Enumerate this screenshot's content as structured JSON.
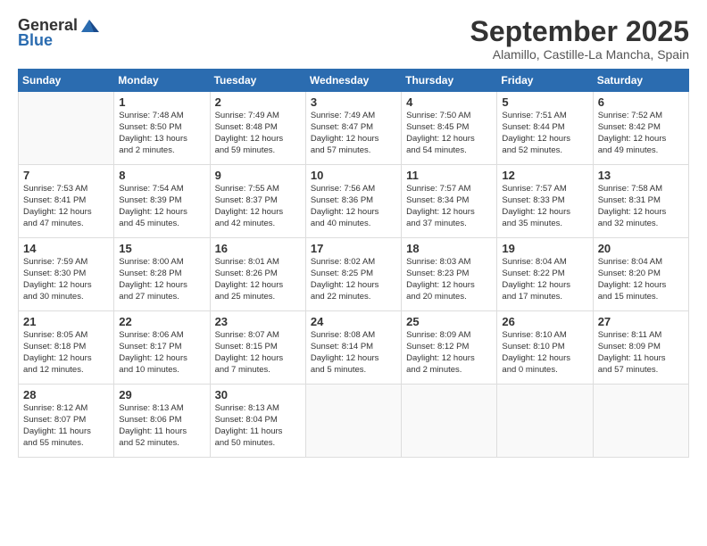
{
  "header": {
    "logo_general": "General",
    "logo_blue": "Blue",
    "month_title": "September 2025",
    "subtitle": "Alamillo, Castille-La Mancha, Spain"
  },
  "days_of_week": [
    "Sunday",
    "Monday",
    "Tuesday",
    "Wednesday",
    "Thursday",
    "Friday",
    "Saturday"
  ],
  "weeks": [
    [
      {
        "day": "",
        "info": ""
      },
      {
        "day": "1",
        "info": "Sunrise: 7:48 AM\nSunset: 8:50 PM\nDaylight: 13 hours\nand 2 minutes."
      },
      {
        "day": "2",
        "info": "Sunrise: 7:49 AM\nSunset: 8:48 PM\nDaylight: 12 hours\nand 59 minutes."
      },
      {
        "day": "3",
        "info": "Sunrise: 7:49 AM\nSunset: 8:47 PM\nDaylight: 12 hours\nand 57 minutes."
      },
      {
        "day": "4",
        "info": "Sunrise: 7:50 AM\nSunset: 8:45 PM\nDaylight: 12 hours\nand 54 minutes."
      },
      {
        "day": "5",
        "info": "Sunrise: 7:51 AM\nSunset: 8:44 PM\nDaylight: 12 hours\nand 52 minutes."
      },
      {
        "day": "6",
        "info": "Sunrise: 7:52 AM\nSunset: 8:42 PM\nDaylight: 12 hours\nand 49 minutes."
      }
    ],
    [
      {
        "day": "7",
        "info": "Sunrise: 7:53 AM\nSunset: 8:41 PM\nDaylight: 12 hours\nand 47 minutes."
      },
      {
        "day": "8",
        "info": "Sunrise: 7:54 AM\nSunset: 8:39 PM\nDaylight: 12 hours\nand 45 minutes."
      },
      {
        "day": "9",
        "info": "Sunrise: 7:55 AM\nSunset: 8:37 PM\nDaylight: 12 hours\nand 42 minutes."
      },
      {
        "day": "10",
        "info": "Sunrise: 7:56 AM\nSunset: 8:36 PM\nDaylight: 12 hours\nand 40 minutes."
      },
      {
        "day": "11",
        "info": "Sunrise: 7:57 AM\nSunset: 8:34 PM\nDaylight: 12 hours\nand 37 minutes."
      },
      {
        "day": "12",
        "info": "Sunrise: 7:57 AM\nSunset: 8:33 PM\nDaylight: 12 hours\nand 35 minutes."
      },
      {
        "day": "13",
        "info": "Sunrise: 7:58 AM\nSunset: 8:31 PM\nDaylight: 12 hours\nand 32 minutes."
      }
    ],
    [
      {
        "day": "14",
        "info": "Sunrise: 7:59 AM\nSunset: 8:30 PM\nDaylight: 12 hours\nand 30 minutes."
      },
      {
        "day": "15",
        "info": "Sunrise: 8:00 AM\nSunset: 8:28 PM\nDaylight: 12 hours\nand 27 minutes."
      },
      {
        "day": "16",
        "info": "Sunrise: 8:01 AM\nSunset: 8:26 PM\nDaylight: 12 hours\nand 25 minutes."
      },
      {
        "day": "17",
        "info": "Sunrise: 8:02 AM\nSunset: 8:25 PM\nDaylight: 12 hours\nand 22 minutes."
      },
      {
        "day": "18",
        "info": "Sunrise: 8:03 AM\nSunset: 8:23 PM\nDaylight: 12 hours\nand 20 minutes."
      },
      {
        "day": "19",
        "info": "Sunrise: 8:04 AM\nSunset: 8:22 PM\nDaylight: 12 hours\nand 17 minutes."
      },
      {
        "day": "20",
        "info": "Sunrise: 8:04 AM\nSunset: 8:20 PM\nDaylight: 12 hours\nand 15 minutes."
      }
    ],
    [
      {
        "day": "21",
        "info": "Sunrise: 8:05 AM\nSunset: 8:18 PM\nDaylight: 12 hours\nand 12 minutes."
      },
      {
        "day": "22",
        "info": "Sunrise: 8:06 AM\nSunset: 8:17 PM\nDaylight: 12 hours\nand 10 minutes."
      },
      {
        "day": "23",
        "info": "Sunrise: 8:07 AM\nSunset: 8:15 PM\nDaylight: 12 hours\nand 7 minutes."
      },
      {
        "day": "24",
        "info": "Sunrise: 8:08 AM\nSunset: 8:14 PM\nDaylight: 12 hours\nand 5 minutes."
      },
      {
        "day": "25",
        "info": "Sunrise: 8:09 AM\nSunset: 8:12 PM\nDaylight: 12 hours\nand 2 minutes."
      },
      {
        "day": "26",
        "info": "Sunrise: 8:10 AM\nSunset: 8:10 PM\nDaylight: 12 hours\nand 0 minutes."
      },
      {
        "day": "27",
        "info": "Sunrise: 8:11 AM\nSunset: 8:09 PM\nDaylight: 11 hours\nand 57 minutes."
      }
    ],
    [
      {
        "day": "28",
        "info": "Sunrise: 8:12 AM\nSunset: 8:07 PM\nDaylight: 11 hours\nand 55 minutes."
      },
      {
        "day": "29",
        "info": "Sunrise: 8:13 AM\nSunset: 8:06 PM\nDaylight: 11 hours\nand 52 minutes."
      },
      {
        "day": "30",
        "info": "Sunrise: 8:13 AM\nSunset: 8:04 PM\nDaylight: 11 hours\nand 50 minutes."
      },
      {
        "day": "",
        "info": ""
      },
      {
        "day": "",
        "info": ""
      },
      {
        "day": "",
        "info": ""
      },
      {
        "day": "",
        "info": ""
      }
    ]
  ]
}
